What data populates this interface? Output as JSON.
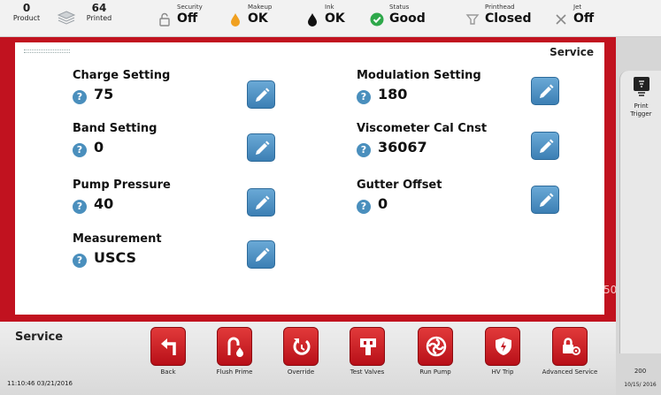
{
  "header": {
    "product": {
      "count": "0",
      "label": "Product"
    },
    "printed": {
      "count": "64",
      "label": "Printed"
    },
    "statuses": [
      {
        "id": "security",
        "label": "Security",
        "value": "Off",
        "icon": "lock-icon"
      },
      {
        "id": "makeup",
        "label": "Makeup",
        "value": "OK",
        "icon": "makeup-drop-icon",
        "color": "#f0a020"
      },
      {
        "id": "ink",
        "label": "Ink",
        "value": "OK",
        "icon": "ink-drop-icon",
        "color": "#111111"
      },
      {
        "id": "status",
        "label": "Status",
        "value": "Good",
        "icon": "check-circle-icon",
        "color": "#2ea84a"
      },
      {
        "id": "printhead",
        "label": "Printhead",
        "value": "Closed",
        "icon": "printhead-icon"
      },
      {
        "id": "jet",
        "label": "Jet",
        "value": "Off",
        "icon": "close-x-icon"
      }
    ]
  },
  "panel": {
    "title": "Service",
    "fields": [
      {
        "id": "charge",
        "label": "Charge Setting",
        "value": "75"
      },
      {
        "id": "band",
        "label": "Band Setting",
        "value": "0"
      },
      {
        "id": "pump",
        "label": "Pump Pressure",
        "value": "40"
      },
      {
        "id": "measurement",
        "label": "Measurement",
        "value": "USCS"
      },
      {
        "id": "modulation",
        "label": "Modulation Setting",
        "value": "180"
      },
      {
        "id": "viscometer",
        "label": "Viscometer Cal Cnst",
        "value": "36067"
      },
      {
        "id": "gutter",
        "label": "Gutter Offset",
        "value": "0"
      }
    ],
    "help_glyph": "?"
  },
  "frame_text": "50",
  "right_rail": {
    "trigger_label_1": "Print",
    "trigger_label_2": "Trigger",
    "bottom_1": "200",
    "bottom_2": "10/15/ 2016"
  },
  "bottom": {
    "title": "Service",
    "datetime": "11:10:46  03/21/2016",
    "buttons": [
      {
        "id": "back",
        "label": "Back",
        "icon": "back-arrow-icon"
      },
      {
        "id": "flush",
        "label": "Flush Prime",
        "icon": "flush-prime-icon"
      },
      {
        "id": "override",
        "label": "Override",
        "icon": "override-icon"
      },
      {
        "id": "testvalves",
        "label": "Test Valves",
        "icon": "test-valves-icon"
      },
      {
        "id": "runpump",
        "label": "Run Pump",
        "icon": "run-pump-icon"
      },
      {
        "id": "hvtrip",
        "label": "HV Trip",
        "icon": "hv-trip-shield-icon"
      },
      {
        "id": "advanced",
        "label": "Advanced Service",
        "icon": "advanced-service-icon"
      }
    ]
  },
  "colors": {
    "frame": "#c1121f",
    "button_red": "#c8141d",
    "edit_blue": "#4a8fbd"
  }
}
